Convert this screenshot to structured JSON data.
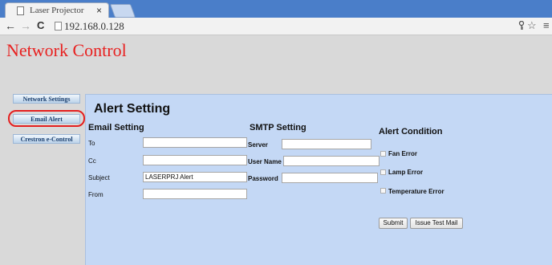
{
  "browser": {
    "tab_title": "Laser Projector",
    "tab_close": "×",
    "address": "192.168.0.128",
    "nav_back": "←",
    "nav_forward": "→",
    "nav_reload": "C",
    "key_icon": "key-icon",
    "star": "☆",
    "menu": "≡"
  },
  "page": {
    "title": "Network Control"
  },
  "sidebar": {
    "items": [
      {
        "label": "Network Settings"
      },
      {
        "label": "Email Alert"
      },
      {
        "label": "Crestron e-Control"
      }
    ],
    "highlight_color": "#e41f1f"
  },
  "alert": {
    "heading": "Alert Setting",
    "email": {
      "heading": "Email Setting",
      "to_label": "To",
      "to_value": "",
      "cc_label": "Cc",
      "cc_value": "",
      "subject_label": "Subject",
      "subject_value": "LASERPRJ Alert",
      "from_label": "From",
      "from_value": ""
    },
    "smtp": {
      "heading": "SMTP Setting",
      "server_label": "Server",
      "server_value": "",
      "username_label": "User Name",
      "username_value": "",
      "password_label": "Password",
      "password_value": ""
    },
    "condition": {
      "heading": "Alert Condition",
      "items": [
        {
          "label": "Fan Error",
          "checked": false
        },
        {
          "label": "Lamp Error",
          "checked": false
        },
        {
          "label": "Temperature Error",
          "checked": false
        }
      ]
    },
    "buttons": {
      "submit": "Submit",
      "test_mail": "Issue Test Mail"
    }
  }
}
